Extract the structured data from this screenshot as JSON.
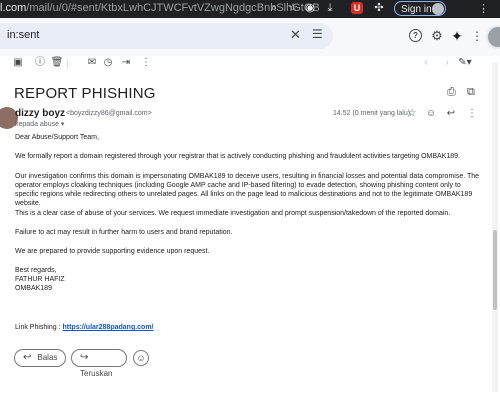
{
  "browser": {
    "url_host": "l.com",
    "url_path": "/mail/u/0/#sent/KtbxLwhCJTWCFvtVZwgNgdgcBnhSlhGtGB",
    "sign_in_label": "Sign in",
    "ext_badge": "U"
  },
  "search": {
    "value": "in:sent"
  },
  "toolbar": {
    "pager": ""
  },
  "email": {
    "subject": "REPORT PHISHING",
    "sender_name": "dizzy boyz",
    "sender_email": "<boyzdizzy86@gmail.com>",
    "to_line": "kepada abuse ▾",
    "time": "14.52 (0 menit yang lalu)",
    "paragraphs": [
      "Dear Abuse/Support Team,",
      "We formally report a domain registered through your registrar that is actively conducting phishing and fraudulent activities targeting OMBAK189.",
      "Our investigation confirms this domain is impersonating OMBAK189 to deceive users, resulting in financial losses and potential data compromise. The operator employs cloaking techniques (including Google AMP cache and IP-based filtering) to evade detection, showing phishing content only to specific regions while redirecting others to unrelated pages. All links on the page lead to malicious destinations and not to the legitimate OMBAK189 website.",
      "This is a clear case of abuse of your services. We request immediate investigation and prompt suspension/takedown of the reported domain.",
      "Failure to act may result in further harm to users and brand reputation.",
      "We are prepared to provide supporting evidence upon request."
    ],
    "signature": [
      "Best regards,",
      "FATHUR HAFIZ",
      "OMBAK189"
    ],
    "link_label": "Link Phishing : ",
    "link_url": "https://ular288padang.com/"
  },
  "actions": {
    "reply_label": "Balas",
    "forward_label": "Teruskan"
  }
}
